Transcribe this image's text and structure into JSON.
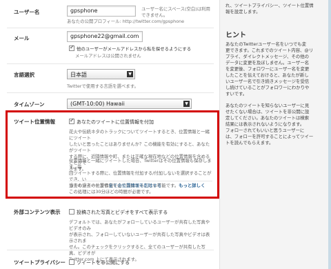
{
  "username": {
    "label": "ユーザー名",
    "value": "gpsphone",
    "hint": "ユーザー名にスペース(空白)は利用できません。",
    "profile_url": "あなたの公開プロフィール: http://twitter.com/gpsphone"
  },
  "email": {
    "label": "メール",
    "value": "gpsphone22@gmail.com",
    "checkbox_label": "他のユーザーがメールアドレスから私を探せるようにする",
    "hint": "メールアドレスは公開されません"
  },
  "language": {
    "label": "言語選択",
    "value": "日本語",
    "hint": "Twitterで使用する言語を選べます。"
  },
  "timezone": {
    "label": "タイムゾーン",
    "value": "(GMT-10:00) Hawaii"
  },
  "geo": {
    "label": "ツイート位置情報",
    "checkbox_label": "あなたのツイートに位置情報を付加",
    "para1_l1": "花火や伝統ネタのトラックについてツイートするとき、位置情報と一緒にツイート",
    "para1_l2": "したいと思ったことはありませんか？この機能を有効にすると、あなたがツイート",
    "para1_l3": "する際に、近隣情報や町、または正確な現在地などの位置情報を含めることがで",
    "para1_l4": "きます。",
    "para2_l1": "位置情報と一緒にツイートした場合、Twitterはその位置情報も保存します。毎",
    "para2_l2": "回ツイートする際に、位置情報を付加する/付加しないを選択することができ、い",
    "para2_l3": "つでも過去の位置情報を全て削除することも可能です。",
    "more_link": "もっと詳しく",
    "delete_prefix": "過去のツイートから",
    "delete_link": "全ての位置情報を削除する",
    "delete_note": "この処理には30分ほどの時間が必要です。"
  },
  "external": {
    "label": "外部コンテンツ表示",
    "checkbox_label": "投稿された写真とビデオをすべて表示する",
    "para_l1": "デフォルトでは、あなたがフォローしているユーザーが共有した写真やビデオのみ",
    "para_l2": "が表示され、フォローしていないユーザーが共有した写真やビデオは表示されま",
    "para_l3": "せん。このチェックをクリックすると、全てのユーザーが共有した写真、ビデオが",
    "para_l4": "Twitter.com 上にて表示されます。"
  },
  "privacy": {
    "label": "ツイートプライバシー",
    "checkbox_label": "ツイートを非公開にする"
  },
  "sidebar": {
    "top_l1": "れ、ツイートプライバシー、ツイート位置情",
    "top_l2": "報を設定します。",
    "hint_title": "ヒント",
    "hint1_l1": "あなたのTwitterユーザー名をいつでも変",
    "hint1_l2": "更できます。これまでのツイート内容、@リ",
    "hint1_l3": "プライ、ダイレクトメッセージ、その他の",
    "hint1_l4": "データに変更を及ぼしません。ユーザー名",
    "hint1_l5": "を変更後、フォロワーにユーザー名を変更",
    "hint1_l6": "したことを伝えておけると、あなたが新し",
    "hint1_l7": "いユーザー名で引き続きメッセージを受信",
    "hint1_l8": "し続けていることがフォロワーにわかりや",
    "hint1_l9": "すいです。",
    "hint2_l1": "あなたのツイートを知らないユーザーに見",
    "hint2_l2": "せたくない場合は、ツイートを非公開に設",
    "hint2_l3": "定してください。あなたのツイートは検索",
    "hint2_l4": "結果には表示されないようになります。",
    "hint2_l5": "フォローされてもいいと思うユーザーに",
    "hint2_l6": "は、フォローを許可することによってツイー",
    "hint2_l7": "トを読んでもらえます。"
  }
}
